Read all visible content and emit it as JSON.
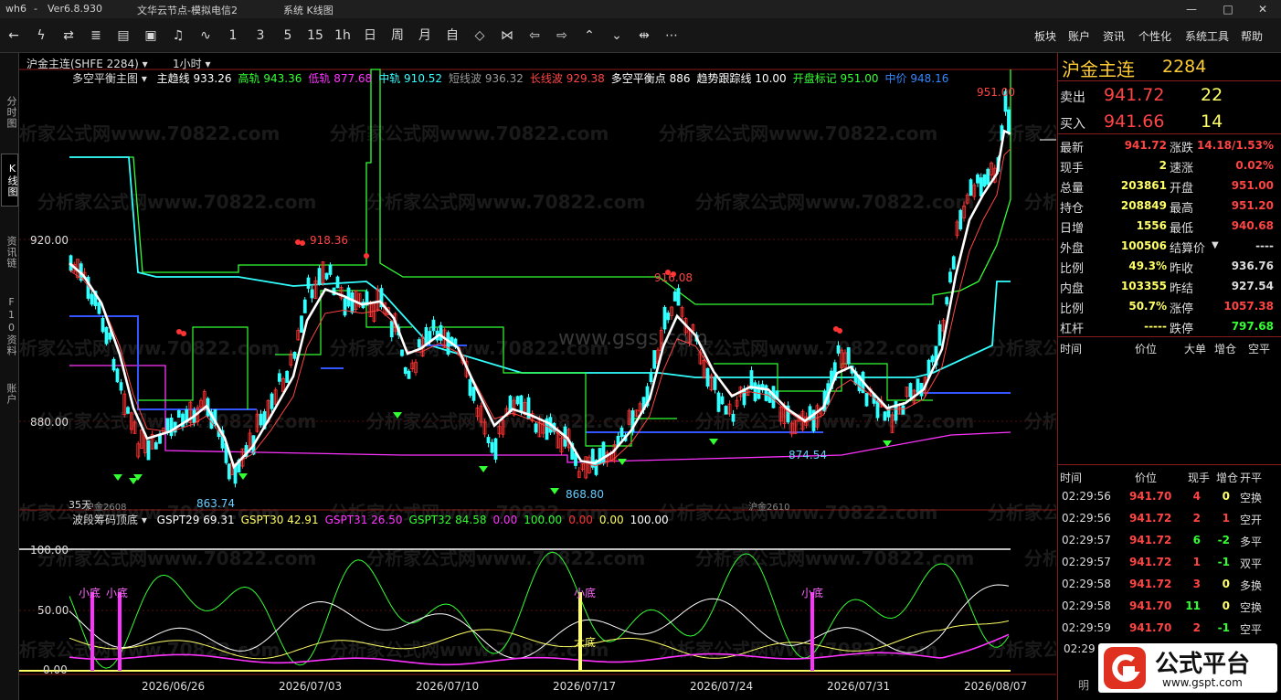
{
  "titlebar": {
    "app": "wh6",
    "sep": "-",
    "version": "Ver6.8.930",
    "server": "文华云节点-模拟电信2",
    "menu": "系统 K线图"
  },
  "toolbar": {
    "menus": [
      "板块",
      "账户",
      "资讯",
      "个性化",
      "系统工具",
      "帮助"
    ],
    "periods": [
      "1",
      "3",
      "5",
      "15",
      "1h",
      "日",
      "周",
      "月",
      "自"
    ]
  },
  "lefttabs": [
    "分时图",
    "K线图",
    "资讯链",
    "F10资料",
    "账户"
  ],
  "instrument": {
    "tab": "沪金主连(SHFE 2284)",
    "period": "1小时"
  },
  "watermark": {
    "text": "分析家公式网www.70822.com",
    "center": "www.gsgs.com"
  },
  "main_indicator": {
    "name": "多空平衡主图",
    "items": [
      {
        "label": "主趋线",
        "value": "933.26",
        "color": "#ffffff"
      },
      {
        "label": "高轨",
        "value": "943.36",
        "color": "#33ff33"
      },
      {
        "label": "低轨",
        "value": "877.68",
        "color": "#ff33ff"
      },
      {
        "label": "中轨",
        "value": "910.52",
        "color": "#33ffff"
      },
      {
        "label": "短线波",
        "value": "936.32",
        "color": "#999999"
      },
      {
        "label": "长线波",
        "value": "929.38",
        "color": "#ff4444"
      },
      {
        "label": "多空平衡点",
        "value": "886",
        "color": "#ffffff"
      },
      {
        "label": "趋势跟踪线",
        "value": "10.00",
        "color": "#ffffff"
      },
      {
        "label": "开盘标记",
        "value": "951.00",
        "color": "#33ff33"
      },
      {
        "label": "中价",
        "value": "948.16",
        "color": "#3388ff"
      }
    ]
  },
  "price_axis": {
    "labels": [
      "920.00",
      "880.00"
    ]
  },
  "price_labels": {
    "high_last": "951.00",
    "p1": "918.36",
    "p2": "916.08",
    "low1": "863.74",
    "low2": "868.80",
    "low3": "874.54",
    "cnt": "35天",
    "contract1": "沪金2608",
    "contract2": "沪金2610"
  },
  "sub_indicator": {
    "name": "波段筹码顶底",
    "items": [
      {
        "label": "GSPT29",
        "value": "69.31",
        "color": "#ffffff"
      },
      {
        "label": "GSPT30",
        "value": "42.91",
        "color": "#ffff66"
      },
      {
        "label": "GSPT31",
        "value": "26.50",
        "color": "#ff33ff"
      },
      {
        "label": "GSPT32",
        "value": "84.58",
        "color": "#33ff33"
      },
      {
        "label": "",
        "value": "0.00",
        "color": "#ff33ff"
      },
      {
        "label": "",
        "value": "100.00",
        "color": "#33ff33"
      },
      {
        "label": "",
        "value": "0.00",
        "color": "#ff3333"
      },
      {
        "label": "",
        "value": "0.00",
        "color": "#ffff66"
      },
      {
        "label": "",
        "value": "100.00",
        "color": "#ffffff"
      }
    ],
    "axis": [
      "100.00",
      "50.00",
      "0.00"
    ],
    "marks": [
      "小底",
      "小底",
      "小底",
      "小底",
      "大底"
    ]
  },
  "dates": [
    "2026/06/26",
    "2026/07/03",
    "2026/07/10",
    "2026/07/17",
    "2026/07/24",
    "2026/07/31",
    "2026/08/07"
  ],
  "quote": {
    "name": "沪金主连",
    "code": "2284",
    "ask": {
      "label": "卖出",
      "price": "941.72",
      "vol": "22"
    },
    "bid": {
      "label": "买入",
      "price": "941.66",
      "vol": "14"
    },
    "rows": [
      [
        "最新",
        "941.72",
        "涨跌",
        "14.18/1.53%"
      ],
      [
        "现手",
        "2",
        "速涨",
        "0.02%"
      ],
      [
        "总量",
        "203861",
        "开盘",
        "951.00"
      ],
      [
        "持仓",
        "208849",
        "最高",
        "951.20"
      ],
      [
        "日增",
        "1556",
        "最低",
        "940.68"
      ],
      [
        "外盘",
        "100506",
        "结算价",
        "----"
      ],
      [
        "比例",
        "49.3%",
        "昨收",
        "936.76"
      ],
      [
        "内盘",
        "103355",
        "昨结",
        "927.54"
      ],
      [
        "比例",
        "50.7%",
        "涨停",
        "1057.38"
      ],
      [
        "杠杆",
        "-----",
        "跌停",
        "797.68"
      ]
    ]
  },
  "tick_header1": [
    "时间",
    "价位",
    "大单",
    "增仓",
    "空平"
  ],
  "tick_header2": [
    "时间",
    "价位",
    "现手",
    "增仓",
    "开平"
  ],
  "ticks": [
    [
      "02:29:56",
      "941.70",
      "4",
      "0",
      "空换"
    ],
    [
      "02:29:56",
      "941.72",
      "2",
      "1",
      "空开"
    ],
    [
      "02:29:57",
      "941.72",
      "6",
      "-2",
      "多平"
    ],
    [
      "02:29:57",
      "941.72",
      "1",
      "-1",
      "双平"
    ],
    [
      "02:29:58",
      "941.72",
      "3",
      "0",
      "多换"
    ],
    [
      "02:29:58",
      "941.70",
      "11",
      "0",
      "空换"
    ],
    [
      "02:29:59",
      "941.70",
      "2",
      "-1",
      "空平"
    ]
  ],
  "tick_partial": "02:29",
  "tick_partial2": "明",
  "logo": {
    "text": "公式平台",
    "url": "www.gspt.com"
  }
}
